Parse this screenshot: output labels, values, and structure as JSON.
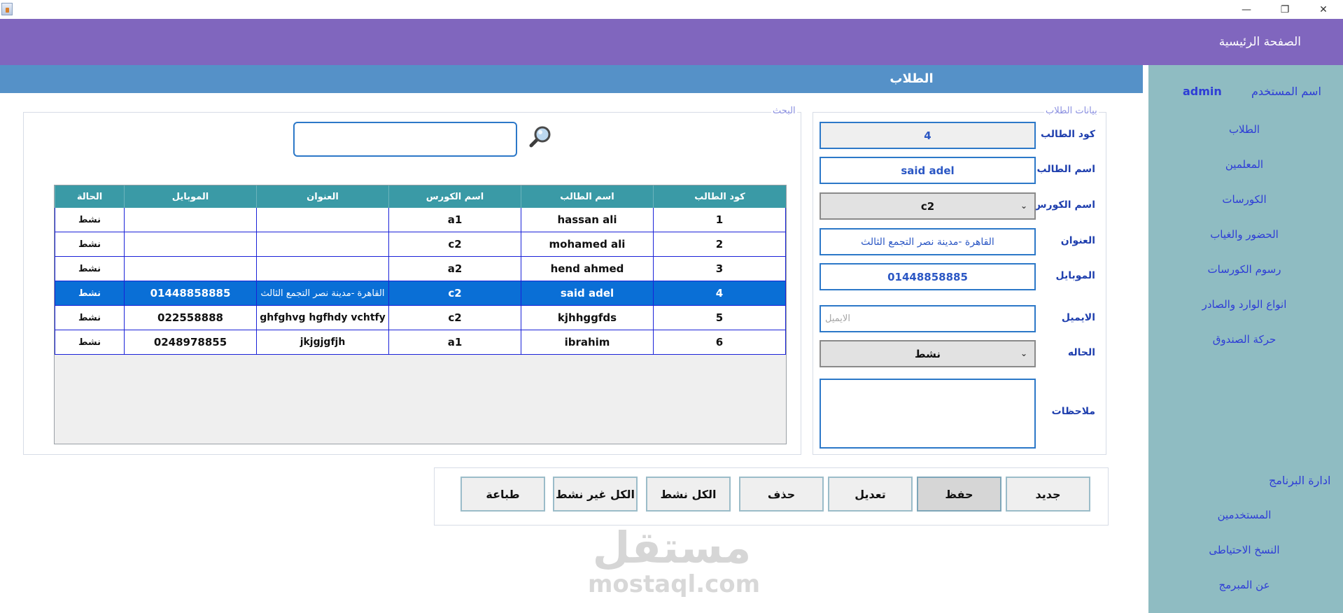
{
  "window": {
    "title": "",
    "controls": {
      "minimize": "—",
      "maximize": "❐",
      "close": "✕"
    }
  },
  "header": {
    "home_title": "الصفحة الرئيسية"
  },
  "section": {
    "title": "الطلاب"
  },
  "sidebar": {
    "user_label": "اسم المستخدم",
    "user_name": "admin",
    "items": [
      "الطلاب",
      "المعلمين",
      "الكورسات",
      "الحضور والغياب",
      "رسوم الكورسات",
      "انواع الوارد والصادر",
      "حركة الصندوق"
    ],
    "admin_title": "ادارة البرنامج",
    "admin_items": [
      "المستخدمين",
      "النسخ الاحتياطى",
      "عن المبرمج"
    ]
  },
  "form": {
    "group_title": "بيانات الطلاب",
    "labels": {
      "code": "كود الطالب",
      "name": "اسم الطالب",
      "course": "اسم الكورس",
      "address": "العنوان",
      "mobile": "الموبايل",
      "email": "الايميل",
      "status": "الحاله",
      "notes": "ملاحظات"
    },
    "values": {
      "code": "4",
      "name": "said adel",
      "course": "c2",
      "address": "القاهرة -مدينة نصر التجمع الثالث",
      "mobile": "01448858885",
      "email_placeholder": "الايميل",
      "status": "نشط",
      "notes": ""
    }
  },
  "search": {
    "group_title": "البحث",
    "value": ""
  },
  "table": {
    "headers": [
      "كود الطالب",
      "اسم الطالب",
      "اسم الكورس",
      "العنوان",
      "الموبايل",
      "الحالة"
    ],
    "rows": [
      [
        "1",
        "hassan ali",
        "a1",
        "",
        "",
        "نشط"
      ],
      [
        "2",
        "mohamed ali",
        "c2",
        "",
        "",
        "نشط"
      ],
      [
        "3",
        "hend ahmed",
        "a2",
        "",
        "",
        "نشط"
      ],
      [
        "4",
        "said adel",
        "c2",
        "القاهرة -مدينة نصر التجمع الثالث",
        "01448858885",
        "نشط"
      ],
      [
        "5",
        "kjhhggfds",
        "c2",
        "ghfghvg hgfhdy  vchtfy",
        "022558888",
        "نشط"
      ],
      [
        "6",
        "ibrahim",
        "a1",
        "jkjgjgfjh",
        "0248978855",
        "نشط"
      ]
    ],
    "selected_row_index": 3
  },
  "buttons": {
    "new": "جديد",
    "save": "حفظ",
    "edit": "تعديل",
    "delete": "حذف",
    "all_active": "الكل نشط",
    "all_inactive": "الكل غير نشط",
    "print": "طباعة"
  },
  "watermark": {
    "arabic": "مستقل",
    "latin": "mostaql.com"
  },
  "colors": {
    "header": "#8066be",
    "section_bar": "#5591c8",
    "sidebar": "#8fbcc2",
    "table_header": "#3a9aa6",
    "selection": "#0a6fd6"
  }
}
